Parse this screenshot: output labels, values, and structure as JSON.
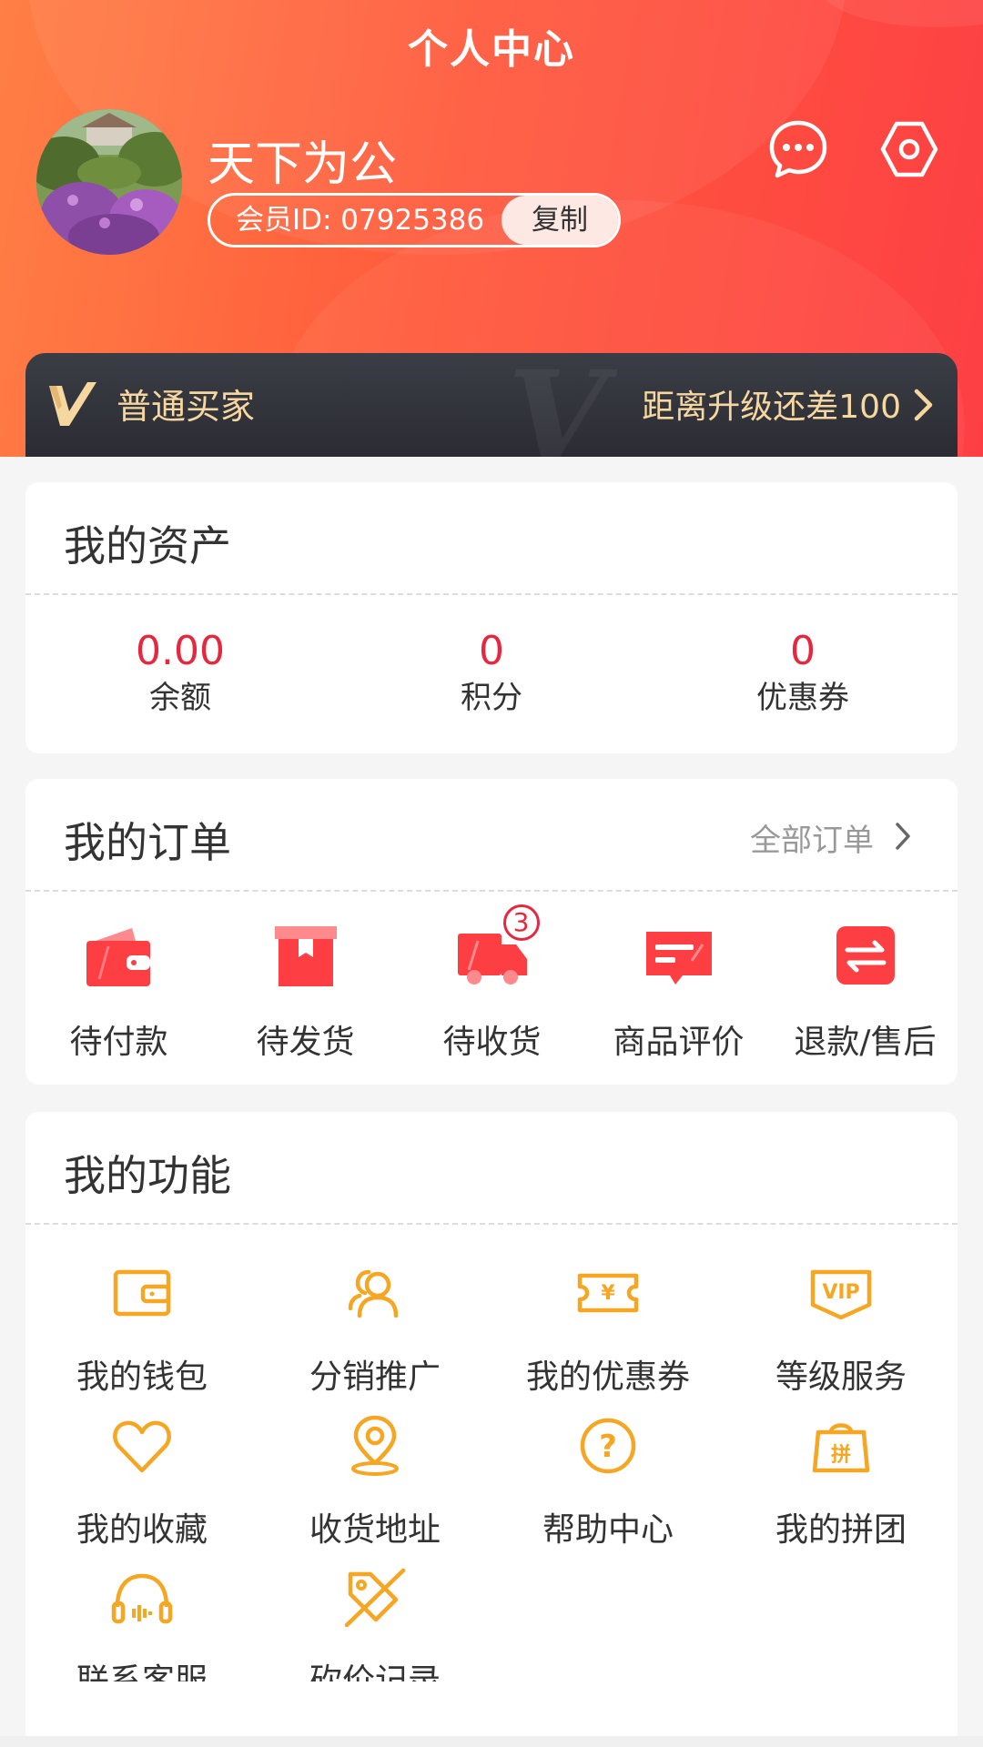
{
  "header": {
    "title": "个人中心",
    "username": "天下为公",
    "member_id": "会员ID: 07925386",
    "copy_label": "复制"
  },
  "vip": {
    "level": "普通买家",
    "upgrade_text": "距离升级还差100"
  },
  "assets": {
    "title": "我的资产",
    "items": [
      {
        "value": "0.00",
        "label": "余额"
      },
      {
        "value": "0",
        "label": "积分"
      },
      {
        "value": "0",
        "label": "优惠券"
      }
    ]
  },
  "orders": {
    "title": "我的订单",
    "all_label": "全部订单",
    "items": [
      {
        "label": "待付款",
        "icon": "wallet-icon"
      },
      {
        "label": "待发货",
        "icon": "box-icon"
      },
      {
        "label": "待收货",
        "icon": "truck-icon",
        "badge": "3"
      },
      {
        "label": "商品评价",
        "icon": "comment-icon"
      },
      {
        "label": "退款/售后",
        "icon": "refund-icon"
      }
    ]
  },
  "functions": {
    "title": "我的功能",
    "items": [
      {
        "label": "我的钱包",
        "icon": "wallet-outline-icon"
      },
      {
        "label": "分销推广",
        "icon": "users-icon"
      },
      {
        "label": "我的优惠券",
        "icon": "coupon-icon"
      },
      {
        "label": "等级服务",
        "icon": "vip-icon"
      },
      {
        "label": "我的收藏",
        "icon": "heart-icon"
      },
      {
        "label": "收货地址",
        "icon": "location-icon"
      },
      {
        "label": "帮助中心",
        "icon": "help-icon"
      },
      {
        "label": "我的拼团",
        "icon": "group-buy-icon"
      },
      {
        "label": "联系客服",
        "icon": "headset-icon"
      },
      {
        "label": "砍价记录",
        "icon": "bargain-tag-icon"
      }
    ]
  },
  "colors": {
    "accent": "#fd3f44",
    "price": "#e5283f",
    "icon_orange": "#f5a623",
    "vip_gold": "#f7d7a0"
  }
}
